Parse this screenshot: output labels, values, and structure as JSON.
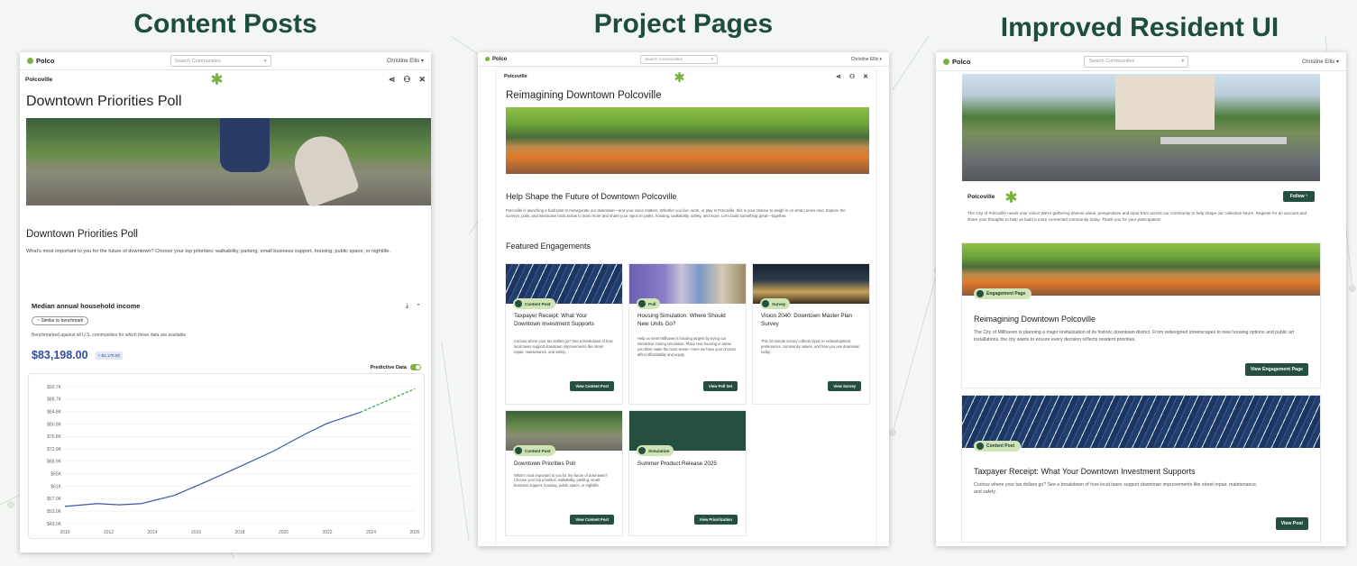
{
  "headings": [
    "Content Posts",
    "Project Pages",
    "Improved Resident UI"
  ],
  "colors": {
    "brand_green": "#25503f",
    "heading_green": "#1e4d3f",
    "accent_lime": "#7bb342",
    "pill_bg": "#cfe3b5",
    "chart_line": "#3d55a8",
    "chart_predicted": "#2ea043"
  },
  "common": {
    "brand": "Polco",
    "search_placeholder": "Search Communities",
    "user": "Christine Ellis",
    "community": "Polcoville"
  },
  "panel1": {
    "page_title": "Downtown Priorities Poll",
    "post_title": "Downtown Priorities Poll",
    "post_body": "What's most important to you for the future of downtown? Choose your top priorities: walkability, parking, small business support, housing, public space, or nightlife.",
    "metric_title": "Median annual household income",
    "benchmark_chip": "Similar to benchmark",
    "benchmark_note": "Benchmarked against all U.S. communities for which these data are available",
    "metric_value": "$83,198.00",
    "metric_delta": "+ $4,170.00",
    "predictive_label": "Predictive Data"
  },
  "chart_data": {
    "type": "line",
    "title": "Median annual household income",
    "xlabel": "",
    "ylabel": "",
    "x_ticks": [
      "2010",
      "2012",
      "2014",
      "2016",
      "2018",
      "2020",
      "2022",
      "2024",
      "2026"
    ],
    "y_ticks": [
      "$49.0K",
      "$53.0K",
      "$57.0K",
      "$61K",
      "$65K",
      "$68.9K",
      "$72.9K",
      "$76.8K",
      "$80.8K",
      "$84.8K",
      "$88.7K",
      "$92.7K"
    ],
    "ylim": [
      49.0,
      92.7
    ],
    "xlim": [
      2010,
      2026
    ],
    "series": [
      {
        "x": [
          2010,
          2011.5,
          2012.5,
          2013.5,
          2015,
          2016.5,
          2018,
          2019.5,
          2021,
          2022,
          2023.5
        ],
        "values": [
          54.5,
          55.4,
          55.0,
          55.4,
          58.0,
          62.5,
          67.2,
          72.0,
          77.6,
          81.0,
          84.5
        ]
      },
      {
        "predicted": true,
        "x": [
          2023.5,
          2024.5,
          2025.5,
          2026
        ],
        "values": [
          84.5,
          87.5,
          90.5,
          92.0
        ]
      }
    ],
    "grid": true
  },
  "panel2": {
    "hero_title": "Reimagining Downtown Polcoville",
    "section_title": "Help Shape the Future of Downtown Polcoville",
    "section_body": "Polcoville is launching a bold plan to reinvigorate our downtown—and your voice matters. Whether you live, work, or play in Polcoville, this is your chance to weigh in on what comes next. Explore the surveys, polls, and interactive tools below to learn more and share your input on parks, housing, walkability, safety, and more. Let's build something great—together.",
    "featured_title": "Featured Engagements",
    "cards": [
      {
        "tag": "Content Post",
        "title": "Taxpayer Receipt: What Your Downtown Investment Supports",
        "body": "Curious where your tax dollars go? See a breakdown of how local taxes support downtown improvements like street repair, maintenance, and safety.",
        "button": "View Content Post"
      },
      {
        "tag": "Poll",
        "title": "Housing Simulation: Where Should New Units Go?",
        "body": "Help us meet Millhaven's housing targets by trying our interactive zoning simulation. Place new housing in areas you think make the most sense—here we have your choices affect affordability and equity.",
        "button": "View Poll Set"
      },
      {
        "tag": "Survey",
        "title": "Vision 2040: Downtown Master Plan Survey",
        "body": "This 10-minute survey collects input on redevelopment preferences, community values, and how you use downtown today.",
        "button": "View Survey"
      },
      {
        "tag": "Content Post",
        "title": "Downtown Priorities Poll",
        "body": "What's most important to you for the future of downtown? Choose your top priorities: walkability, parking, small business support, housing, public space, or nightlife.",
        "button": "View Content Post"
      },
      {
        "tag": "Simulation",
        "title": "Summer Product Release 2025",
        "body": "",
        "button": "View Prioritization"
      }
    ]
  },
  "panel3": {
    "follow_button": "Follow",
    "community_body": "The City of Polcoville needs your voice! We're gathering diverse ideas, perspectives and input from across our community to help shape our collective future. Register for an account and share your thoughts to help us build a more connected community today. Thank you for your participation!",
    "card1": {
      "tag": "Engagement Page",
      "title": "Reimagining Downtown Polcoville",
      "body": "The City of Millhaven is planning a major revitalization of its historic downtown district. From redesigned streetscapes to new housing options and public art installations, the city wants to ensure every decision reflects resident priorities.",
      "button": "View Engagement Page"
    },
    "card2": {
      "tag": "Content Post",
      "title": "Taxpayer Receipt: What Your Downtown Investment Supports",
      "body": "Curious where your tax dollars go? See a breakdown of how local taxes support downtown improvements like street repair, maintenance, and safety.",
      "button": "View Post"
    }
  }
}
